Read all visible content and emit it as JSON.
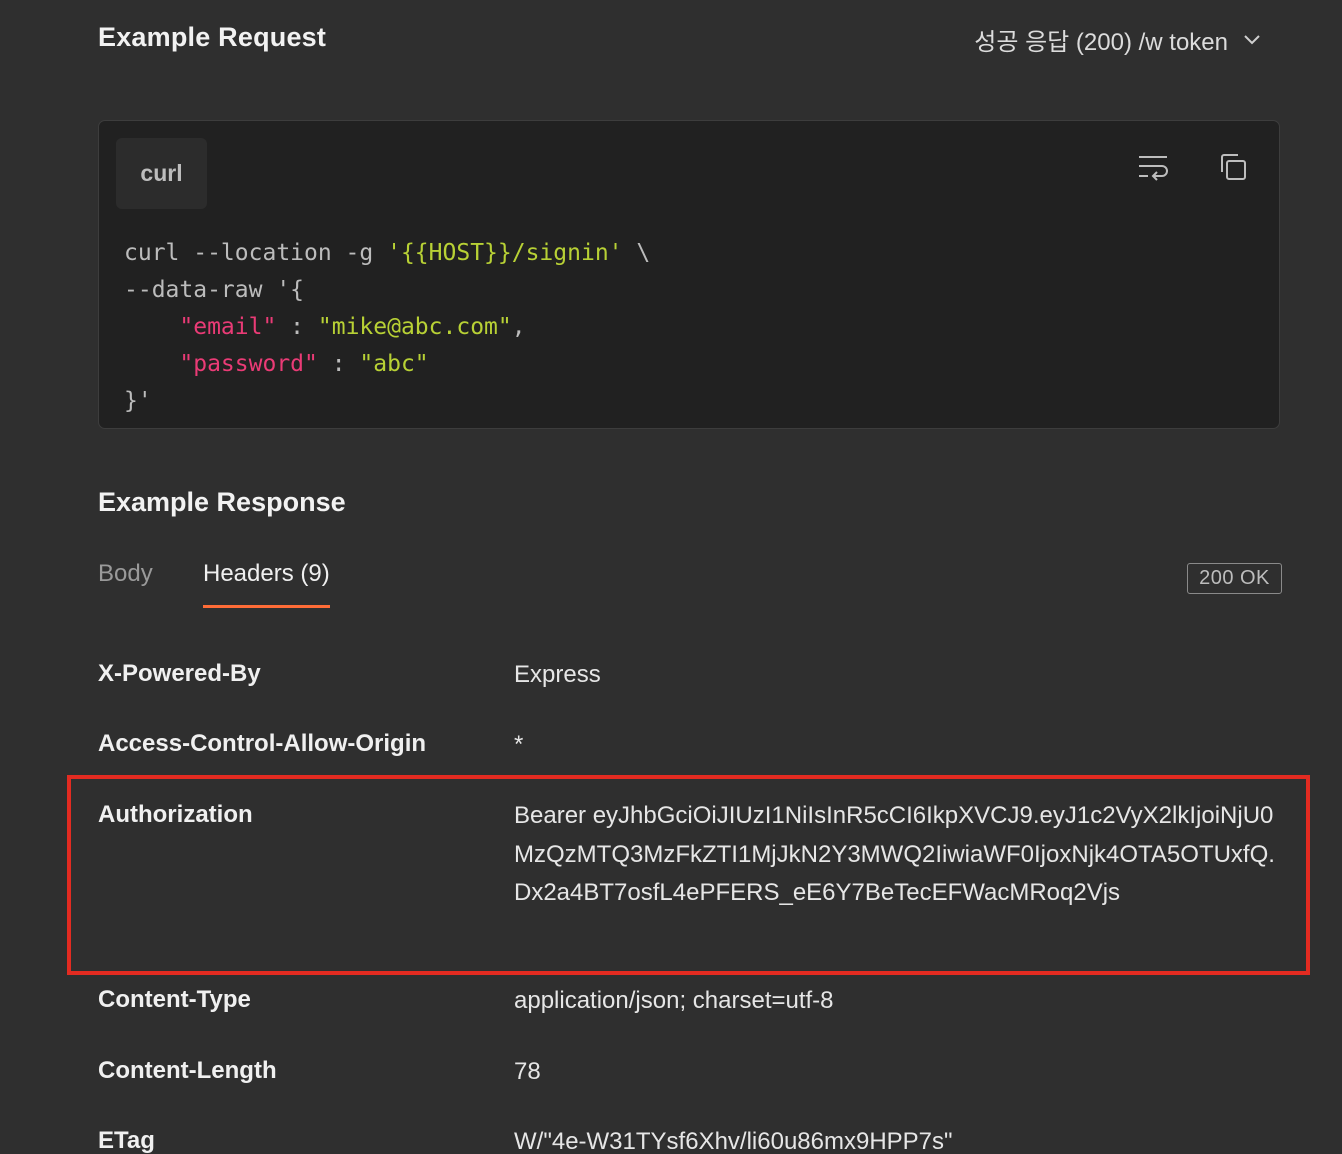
{
  "request": {
    "title": "Example Request",
    "selected_example": "성공 응답 (200) /w token",
    "language_tab": "curl",
    "code_lines": [
      [
        {
          "t": "curl --location -g ",
          "c": "plain"
        },
        {
          "t": "'{{HOST}}/signin'",
          "c": "str"
        },
        {
          "t": " \\",
          "c": "plain"
        }
      ],
      [
        {
          "t": "--data-raw '{",
          "c": "plain"
        }
      ],
      [
        {
          "t": "    ",
          "c": "plain"
        },
        {
          "t": "\"email\"",
          "c": "key"
        },
        {
          "t": " : ",
          "c": "plain"
        },
        {
          "t": "\"mike@abc.com\"",
          "c": "str"
        },
        {
          "t": ",",
          "c": "plain"
        }
      ],
      [
        {
          "t": "    ",
          "c": "plain"
        },
        {
          "t": "\"password\"",
          "c": "key"
        },
        {
          "t": " : ",
          "c": "plain"
        },
        {
          "t": "\"abc\"",
          "c": "str"
        }
      ],
      [
        {
          "t": "}'",
          "c": "plain"
        }
      ]
    ],
    "icons": {
      "wrap": "wrap-lines-icon",
      "copy": "copy-icon",
      "chevron": "chevron-down-icon"
    }
  },
  "response": {
    "title": "Example Response",
    "tabs": {
      "body": "Body",
      "headers": "Headers (9)"
    },
    "status": "200 OK",
    "headers": [
      {
        "key": "X-Powered-By",
        "value": "Express"
      },
      {
        "key": "Access-Control-Allow-Origin",
        "value": "*"
      },
      {
        "key": "Authorization",
        "value": "Bearer eyJhbGciOiJIUzI1NiIsInR5cCI6IkpXVCJ9.eyJ1c2VyX2lkIjoiNjU0MzQzMTQ3MzFkZTI1MjJkN2Y3MWQ2IiwiaWF0IjoxNjk4OTA5OTUxfQ.Dx2a4BT7osfL4ePFERS_eE6Y7BeTecEFWacMRoq2Vjs"
      },
      {
        "key": "Content-Type",
        "value": "application/json; charset=utf-8"
      },
      {
        "key": "Content-Length",
        "value": "78"
      },
      {
        "key": "ETag",
        "value": "W/\"4e-W31TYsf6Xhv/li60u86mx9HPP7s\""
      }
    ]
  },
  "colors": {
    "background": "#2f2f2f",
    "code_background": "#212121",
    "string": "#b8d135",
    "key": "#ea3b76",
    "tab_accent": "#ff6c37",
    "highlight": "#e32b21"
  }
}
